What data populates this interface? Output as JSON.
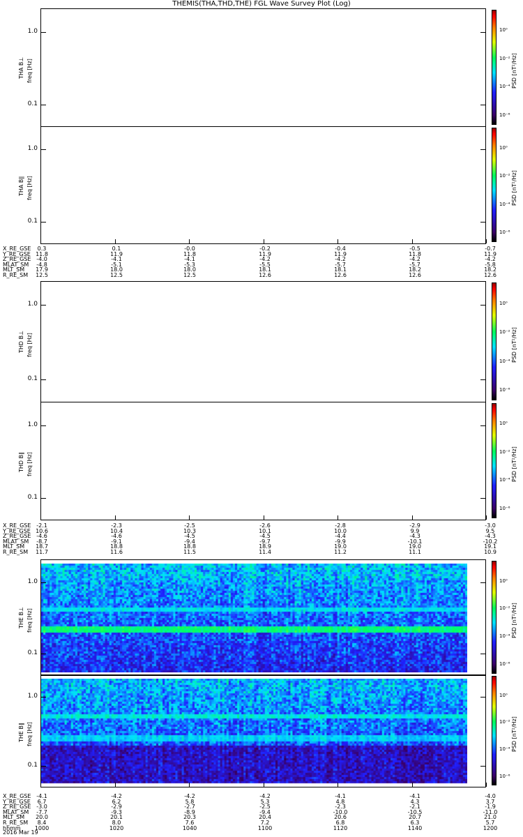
{
  "title": "THEMIS(THA,THD,THE) FGL Wave Survey Plot (Log)",
  "panels": [
    {
      "label": "THA B⊥",
      "ylabel": "freq [Hz]",
      "has_data": false
    },
    {
      "label": "THA B∥",
      "ylabel": "freq [Hz]",
      "has_data": false
    },
    {
      "label": "THD B⊥",
      "ylabel": "freq [Hz]",
      "has_data": false
    },
    {
      "label": "THD B∥",
      "ylabel": "freq [Hz]",
      "has_data": false
    },
    {
      "label": "THE B⊥",
      "ylabel": "freq [Hz]",
      "has_data": true
    },
    {
      "label": "THE B∥",
      "ylabel": "freq [Hz]",
      "has_data": true
    }
  ],
  "yticks": [
    "1.0",
    "0.1"
  ],
  "colorbar": {
    "label": "PSD [nT²/Hz]",
    "ticks": [
      "10⁰",
      "10⁻²",
      "10⁻⁴",
      "10⁻⁶"
    ]
  },
  "ephem": [
    {
      "rows": [
        {
          "name": "X_RE_GSE",
          "values": [
            "0.3",
            "0.1",
            "-0.0",
            "-0.2",
            "-0.4",
            "-0.5",
            "-0.7"
          ]
        },
        {
          "name": "Y_RE_GSE",
          "values": [
            "11.8",
            "11.9",
            "11.8",
            "11.9",
            "11.9",
            "11.8",
            "11.9"
          ]
        },
        {
          "name": "Z_RE_GSE",
          "values": [
            "-4.0",
            "-4.1",
            "-4.1",
            "-4.2",
            "-4.2",
            "-4.2",
            "-4.2"
          ]
        },
        {
          "name": "MLAT_SM",
          "values": [
            "-4.8",
            "-5.1",
            "-5.3",
            "-5.5",
            "-5.7",
            "-5.7",
            "-5.8"
          ]
        },
        {
          "name": "MLT_SM",
          "values": [
            "17.9",
            "18.0",
            "18.0",
            "18.1",
            "18.1",
            "18.2",
            "18.2"
          ]
        },
        {
          "name": "R_RE_SM",
          "values": [
            "12.5",
            "12.5",
            "12.5",
            "12.6",
            "12.6",
            "12.6",
            "12.6"
          ]
        }
      ]
    },
    {
      "rows": [
        {
          "name": "X_RE_GSE",
          "values": [
            "-2.1",
            "-2.3",
            "-2.5",
            "-2.6",
            "-2.8",
            "-2.9",
            "-3.0"
          ]
        },
        {
          "name": "Y_RE_GSE",
          "values": [
            "10.6",
            "10.4",
            "10.3",
            "10.1",
            "10.0",
            "9.9",
            "9.5"
          ]
        },
        {
          "name": "Z_RE_GSE",
          "values": [
            "-4.6",
            "-4.6",
            "-4.5",
            "-4.5",
            "-4.4",
            "-4.3",
            "-4.3"
          ]
        },
        {
          "name": "MLAT_SM",
          "values": [
            "-8.7",
            "-9.1",
            "-9.4",
            "-9.7",
            "-9.9",
            "-10.1",
            "-10.2"
          ]
        },
        {
          "name": "MLT_SM",
          "values": [
            "18.7",
            "18.8",
            "18.8",
            "18.9",
            "19.0",
            "19.0",
            "19.1"
          ]
        },
        {
          "name": "R_RE_SM",
          "values": [
            "11.7",
            "11.6",
            "11.5",
            "11.4",
            "11.2",
            "11.1",
            "10.9"
          ]
        }
      ]
    },
    {
      "rows": [
        {
          "name": "X_RE_GSE",
          "values": [
            "-4.1",
            "-4.2",
            "-4.2",
            "-4.2",
            "-4.1",
            "-4.1",
            "-4.0"
          ]
        },
        {
          "name": "Y_RE_GSE",
          "values": [
            "6.7",
            "6.2",
            "5.8",
            "5.3",
            "4.8",
            "4.3",
            "3.7"
          ]
        },
        {
          "name": "Z_RE_GSE",
          "values": [
            "-3.0",
            "-2.9",
            "-2.7",
            "-2.5",
            "-2.3",
            "-2.1",
            "-1.9"
          ]
        },
        {
          "name": "MLAT_SM",
          "values": [
            "-7.7",
            "-9.3",
            "-8.9",
            "-9.4",
            "-10.0",
            "-10.5",
            "-11.0"
          ]
        },
        {
          "name": "MLT_SM",
          "values": [
            "20.0",
            "20.1",
            "20.3",
            "20.4",
            "20.6",
            "20.7",
            "21.0"
          ]
        },
        {
          "name": "R_RE_SM",
          "values": [
            "8.4",
            "8.0",
            "7.6",
            "7.2",
            "6.8",
            "6.3",
            "5.7"
          ]
        },
        {
          "name": "hhmm",
          "values": [
            "1000",
            "1020",
            "1040",
            "1100",
            "1120",
            "1140",
            "1200"
          ]
        }
      ]
    }
  ],
  "date": "2016 Mar 19",
  "chart_data": {
    "type": "heatmap",
    "title": "THEMIS(THA,THD,THE) FGL Wave Survey Plot (Log)",
    "xlabel": "hhmm",
    "x_ticks": [
      "1000",
      "1020",
      "1040",
      "1100",
      "1120",
      "1140",
      "1200"
    ],
    "ylabel": "freq [Hz]",
    "yscale": "log",
    "ylim": [
      0.05,
      2.1
    ],
    "zlabel": "PSD [nT²/Hz]",
    "zlim": [
      1e-07,
      10.0
    ]
  }
}
